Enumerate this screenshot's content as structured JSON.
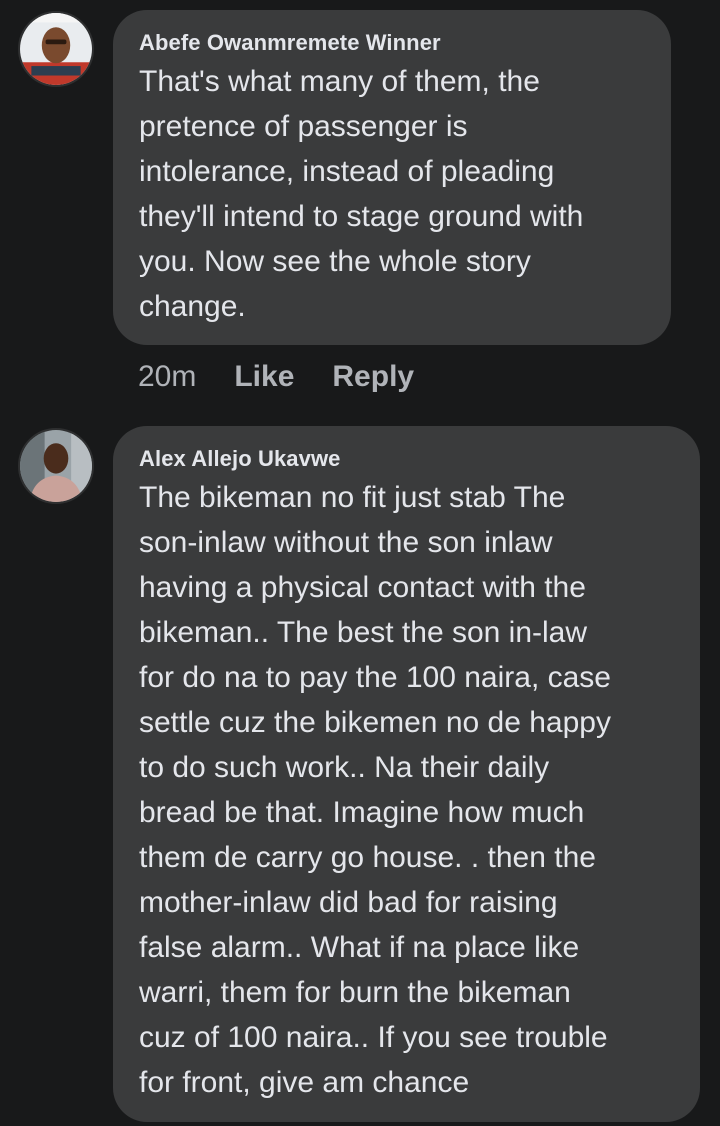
{
  "comments": [
    {
      "author": "Abefe Owanmremete Winner",
      "text": "That's what many of them, the\npretence of passenger is\nintolerance, instead of pleading\nthey'll intend to stage ground with\nyou. Now see the whole story\nchange.",
      "time": "20m",
      "like_label": "Like",
      "reply_label": "Reply"
    },
    {
      "author": "Alex Allejo Ukavwe",
      "text": "The bikeman no fit just stab The\nson-inlaw without the son inlaw\nhaving a physical contact with the\nbikeman..  The best the son in-law\nfor do na to pay the 100 naira, case\nsettle cuz the bikemen no de happy\nto do such work..  Na their daily\nbread be that.  Imagine how much\nthem de carry go house. . then the\nmother-inlaw did bad for raising\nfalse alarm..  What if na place like\nwarri,  them for burn the bikeman\ncuz of 100 naira..  If you see trouble\nfor front,  give am chance"
    }
  ],
  "colors": {
    "background": "#18191a",
    "bubble": "#3a3b3c",
    "text": "#e4e6eb",
    "secondary_text": "#b0b3b8"
  }
}
